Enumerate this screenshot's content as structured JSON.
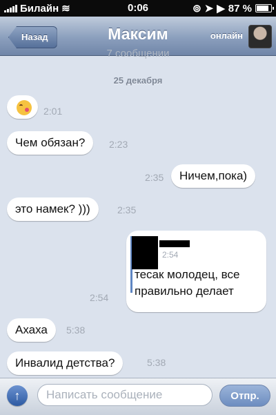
{
  "status_bar": {
    "carrier": "Билайн",
    "time": "0:06",
    "battery": "87 %",
    "battery_level": 0.87
  },
  "nav": {
    "back_label": "Назад",
    "title": "Максим",
    "presence": "онлайн"
  },
  "conversation": {
    "faded_text": "7 сообщении",
    "date": "25 декабря",
    "messages": [
      {
        "direction": "incoming",
        "emoji": "kissing-face",
        "time": "2:01"
      },
      {
        "direction": "incoming",
        "text": "Чем обязан?",
        "time": "2:23"
      },
      {
        "direction": "outgoing",
        "text": "Ничем,пока)",
        "time": "2:35"
      },
      {
        "direction": "incoming",
        "text": "это намек? )))",
        "time": "2:35"
      },
      {
        "direction": "outgoing",
        "quote_time": "2:54",
        "text_lines": [
          "тесак молодец, все",
          "правильно делает"
        ],
        "time": "2:54"
      },
      {
        "direction": "incoming",
        "text": "Ахаха",
        "time": "5:38"
      },
      {
        "direction": "incoming",
        "text": "Инвалид детства?",
        "time": "5:38"
      }
    ]
  },
  "composer": {
    "placeholder": "Написать сообщение",
    "send_label": "Отпр."
  },
  "colors": {
    "accent": "#5f86c2",
    "background": "#dbe2ed"
  }
}
